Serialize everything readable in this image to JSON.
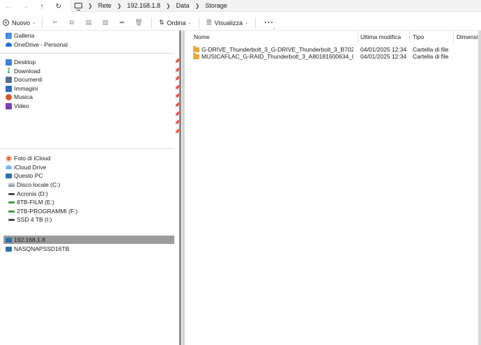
{
  "address": {
    "breadcrumbs": [
      "Rete",
      "192.168.1.8",
      "Data",
      "Storage"
    ]
  },
  "toolbar": {
    "new_label": "Nuovo",
    "sort_label": "Ordina",
    "view_label": "Visualizza",
    "more_label": "···"
  },
  "nav": {
    "top": [
      {
        "label": "Galleria",
        "icon": "gallery-icon"
      },
      {
        "label": "OneDrive - Personal",
        "icon": "onedrive-icon"
      }
    ],
    "quick": [
      {
        "label": "Desktop",
        "icon": "desktop-icon"
      },
      {
        "label": "Download",
        "icon": "download-icon"
      },
      {
        "label": "Documenti",
        "icon": "documents-icon"
      },
      {
        "label": "Immagini",
        "icon": "pictures-icon"
      },
      {
        "label": "Musica",
        "icon": "music-icon"
      },
      {
        "label": "Video",
        "icon": "video-icon"
      }
    ],
    "devices": [
      {
        "label": "Foto di iCloud",
        "icon": "icloud-photos-icon"
      },
      {
        "label": "iCloud Drive",
        "icon": "icloud-drive-icon"
      },
      {
        "label": "Questo PC",
        "icon": "this-pc-icon"
      },
      {
        "label": "Disco locale (C:)",
        "icon": "local-disk-icon"
      },
      {
        "label": "Acronis (D:)",
        "icon": "drive-icon"
      },
      {
        "label": "8TB-FILM (E:)",
        "icon": "drive-icon"
      },
      {
        "label": "2TB-PROGRAMMI (F:)",
        "icon": "drive-icon"
      },
      {
        "label": "SSD 4 TB (I:)",
        "icon": "drive-icon"
      }
    ],
    "network": [
      {
        "label": "192.168.1.8",
        "icon": "network-pc-icon",
        "selected": true
      },
      {
        "label": "NASQNAPSSD16TB",
        "icon": "network-pc-icon"
      }
    ]
  },
  "columns": {
    "name": "Nome",
    "modified": "Ultima modifica",
    "type": "Tipo",
    "size": "Dimensi..."
  },
  "files": [
    {
      "name": "G-DRIVE_Thunderbolt_3_G-DRIVE_Thunderbolt_3_B702023001...",
      "modified": "04/01/2025 12:34",
      "type": "Cartella di file"
    },
    {
      "name": "MUSICAFLAC_G-RAID_Thunderbolt_3_A80181600634_0CA107C...",
      "modified": "04/01/2025 12:34",
      "type": "Cartella di file"
    }
  ]
}
